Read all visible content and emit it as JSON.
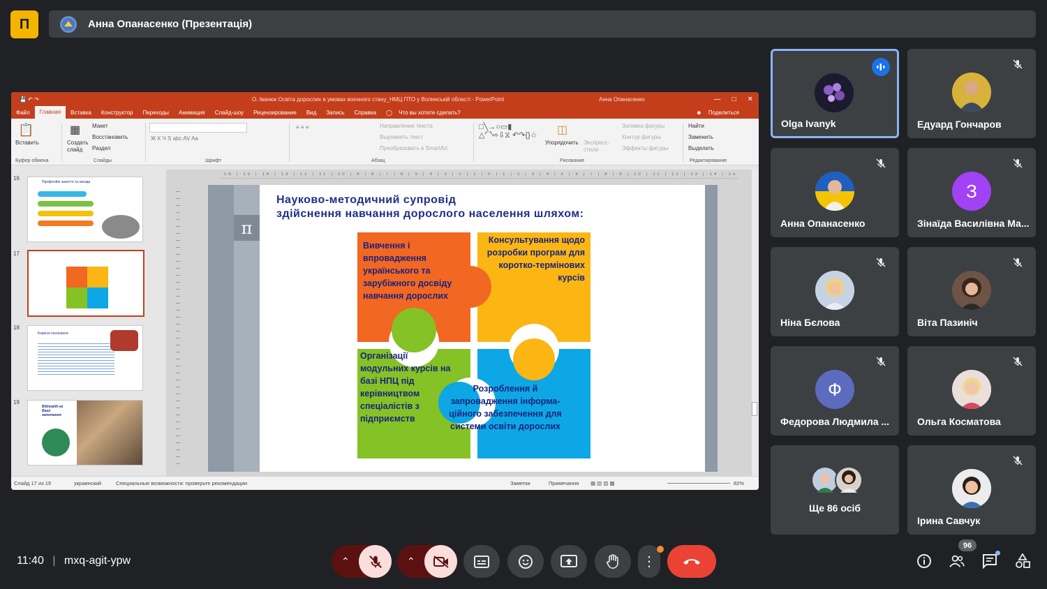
{
  "meet": {
    "presenter_title": "Анна Опанасенко (Презентація)",
    "logo_glyph": "П",
    "time": "11:40",
    "meeting_code": "mxq-agit-ypw",
    "participants_count": "96",
    "accent": "#8ab4f8",
    "end_call_color": "#ea4335"
  },
  "ppt": {
    "window_title": "О. Іванюк Освіта дорослих в умовах воєнного стану_НМЦ ПТО у Волинській області  -  PowerPoint",
    "user": "Анна Опанасенко",
    "menu": [
      "Файл",
      "Главная",
      "Вставка",
      "Конструктор",
      "Переходы",
      "Анимация",
      "Слайд-шоу",
      "Рецензирование",
      "Вид",
      "Запись",
      "Справка",
      "Что вы хотите сделать?"
    ],
    "share": "Поделиться",
    "ribbon": {
      "paste": "Вставить",
      "clipboard": "Буфер обмена",
      "new_slide": "Создать слайд",
      "layout": "Макет",
      "reset": "Восстановить",
      "section": "Раздел",
      "slides": "Слайды",
      "font": "Шрифт",
      "text_dir": "Направление текста",
      "align_text": "Выровнять текст",
      "smartart": "Преобразовать в SmartArt",
      "paragraph": "Абзац",
      "arrange": "Упорядочить",
      "quick_styles": "Экспресс-стили",
      "shape_fill": "Заливка фигуры",
      "shape_outline": "Контур фигуры",
      "shape_effects": "Эффекты фигуры",
      "drawing": "Рисование",
      "find": "Найти",
      "replace": "Заменить",
      "select": "Выделить",
      "editing": "Редактирование"
    },
    "slide_numbers": [
      "16",
      "17",
      "18",
      "19"
    ],
    "thumb16_title": "Професійні заняття та заходи",
    "thumb18_title": "Корисні посилання",
    "thumb19_text": "Відповіді на Ваші запитання",
    "slide": {
      "title_line1": "Науково-методичний  супровід",
      "title_line2": "здійснення  навчання  дорослого  населення  шляхом:",
      "pi": "π",
      "piece_tl": "Вивчення  і впровадження українського  та зарубіжного  досвіду навчання  дорослих",
      "piece_tr": "Консультування щодо  розробки програм  для коротко-термінових курсів",
      "piece_bl": "Організації модульних  курсів на  базі  НПЦ  під керівництвом спеціалістів  з підприємств",
      "piece_br": "Розроблення  й запровадження  інформа-ційного забезпечення  для системи  освіти дорослих"
    },
    "status": {
      "slide_of": "Слайд 17 из 19",
      "lang": "украинский",
      "accessibility": "Специальные возможности: проверьте рекомендации",
      "notes": "Заметки",
      "comments": "Примечания",
      "zoom": "82%"
    }
  },
  "tiles": [
    {
      "name": "Olga Ivanyk",
      "active": true
    },
    {
      "name": "Едуард Гончаров"
    },
    {
      "name": "Анна Опанасенко"
    },
    {
      "name": "Зінаїда Василівна Ма...",
      "initial": "З",
      "color": "#a142f4"
    },
    {
      "name": "Ніна Бєлова"
    },
    {
      "name": "Віта Пазиніч"
    },
    {
      "name": "Федорова Людмила ...",
      "initial": "Ф",
      "color": "#5c6bc0"
    },
    {
      "name": "Ольга Косматова"
    },
    {
      "name": "Ще 86 осіб"
    },
    {
      "name": "Ірина Савчук"
    }
  ]
}
